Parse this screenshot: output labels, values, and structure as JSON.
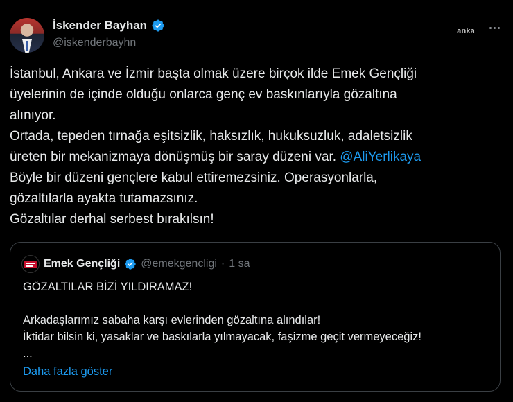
{
  "author": {
    "display_name": "İskender Bayhan",
    "handle": "@iskenderbayhn",
    "verified_icon": "verified-badge-icon"
  },
  "watermark": "anka",
  "more_icon": "more-options-icon",
  "tweet": {
    "lines": [
      "İstanbul, Ankara ve İzmir başta olmak üzere birçok ilde Emek Gençliği",
      "üyelerinin de içinde olduğu onlarca genç ev baskınlarıyla gözaltına",
      "alınıyor.",
      "Ortada, tepeden tırnağa eşitsizlik, haksızlık, hukuksuzluk, adaletsizlik",
      "üreten bir mekanizmaya dönüşmüş bir saray düzeni var.",
      "Böyle bir düzeni gençlere kabul ettiremezsiniz. Operasyonlarla,",
      "gözaltılarla ayakta tutamazsınız.",
      "Gözaltılar derhal serbest bırakılsın!"
    ],
    "mention": "@AliYerlikaya"
  },
  "quote": {
    "display_name": "Emek Gençliği",
    "handle": "@emekgencligi",
    "separator": "·",
    "time": "1 sa",
    "lines": [
      "GÖZALTILAR BİZİ YILDIRAMAZ!",
      "Arkadaşlarımız sabaha karşı evlerinden gözaltına alındılar!",
      "İktidar bilsin ki, yasaklar ve baskılarla yılmayacak, faşizme geçit vermeyeceğiz!",
      "..."
    ],
    "show_more": "Daha fazla göster"
  },
  "colors": {
    "background": "#000000",
    "text": "#e7e9ea",
    "secondary": "#71767b",
    "link": "#1d9bf0",
    "border": "#3a3f44"
  }
}
